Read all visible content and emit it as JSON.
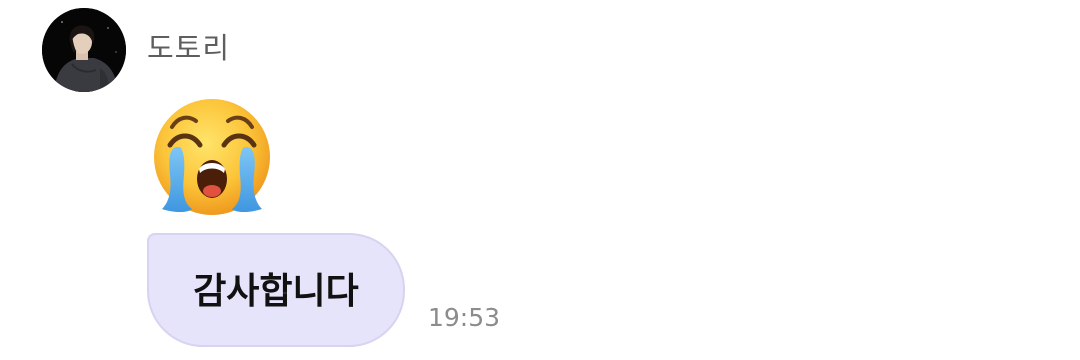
{
  "chat": {
    "message": {
      "sender": {
        "name": "도토리",
        "avatar": "profile-photo"
      },
      "sticker": {
        "icon": "loudly-crying-face-emoji"
      },
      "text": "감사합니다",
      "time": "19:53",
      "bubble_color": "#e6e4fb"
    }
  }
}
